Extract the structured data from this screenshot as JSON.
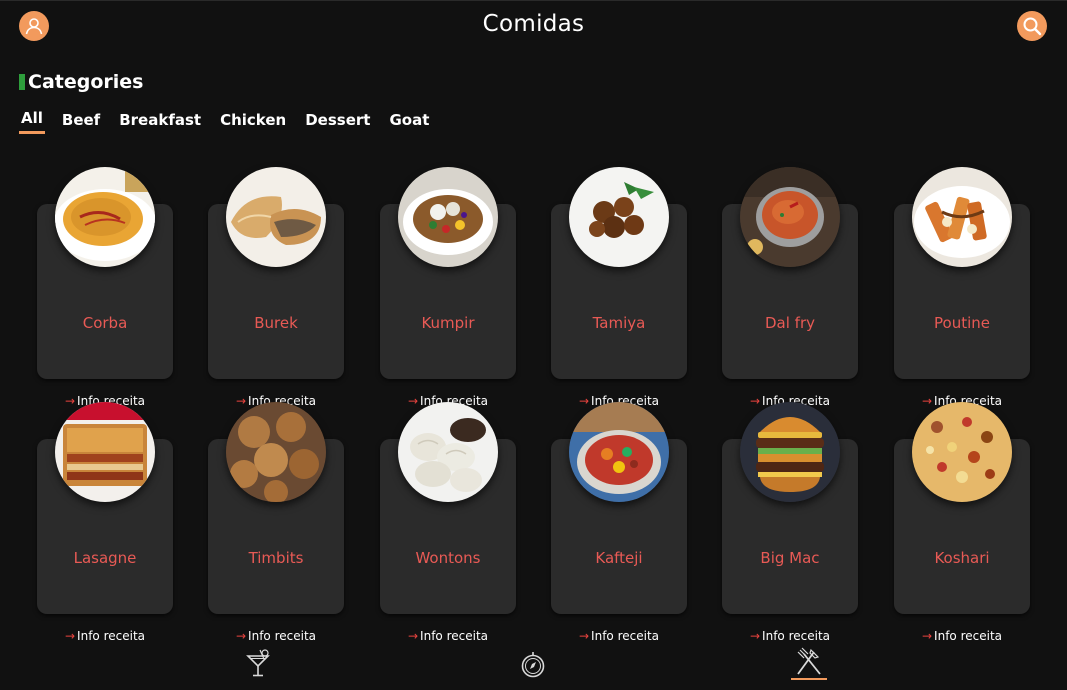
{
  "header": {
    "title": "Comidas",
    "profile_icon": "profile-icon",
    "search_icon": "search-icon",
    "accent_color": "#f29a5d"
  },
  "categories": {
    "title": "Categories",
    "marker_color": "#2e9e3c",
    "tabs": [
      {
        "label": "All",
        "active": true
      },
      {
        "label": "Beef",
        "active": false
      },
      {
        "label": "Breakfast",
        "active": false
      },
      {
        "label": "Chicken",
        "active": false
      },
      {
        "label": "Dessert",
        "active": false
      },
      {
        "label": "Goat",
        "active": false
      }
    ]
  },
  "recipes": [
    {
      "name": "Corba",
      "link_label": "Info receita",
      "link_arrow": "→"
    },
    {
      "name": "Burek",
      "link_label": "Info receita",
      "link_arrow": "→"
    },
    {
      "name": "Kumpir",
      "link_label": "Info receita",
      "link_arrow": "→"
    },
    {
      "name": "Tamiya",
      "link_label": "Info receita",
      "link_arrow": "→"
    },
    {
      "name": "Dal fry",
      "link_label": "Info receita",
      "link_arrow": "→"
    },
    {
      "name": "Poutine",
      "link_label": "Info receita",
      "link_arrow": "→"
    },
    {
      "name": "Lasagne",
      "link_label": "Info receita",
      "link_arrow": "→"
    },
    {
      "name": "Timbits",
      "link_label": "Info receita",
      "link_arrow": "→"
    },
    {
      "name": "Wontons",
      "link_label": "Info receita",
      "link_arrow": "→"
    },
    {
      "name": "Kafteji",
      "link_label": "Info receita",
      "link_arrow": "→"
    },
    {
      "name": "Big Mac",
      "link_label": "Info receita",
      "link_arrow": "→"
    },
    {
      "name": "Koshari",
      "link_label": "Info receita",
      "link_arrow": "→"
    }
  ],
  "bottom_nav": {
    "items": [
      {
        "icon": "cocktail-icon",
        "active": false
      },
      {
        "icon": "compass-icon",
        "active": false
      },
      {
        "icon": "fork-knife-icon",
        "active": true
      }
    ]
  },
  "colors": {
    "background": "#111111",
    "card": "#2b2b2b",
    "recipe_name": "#e85a55",
    "link_arrow": "#e8433e"
  }
}
